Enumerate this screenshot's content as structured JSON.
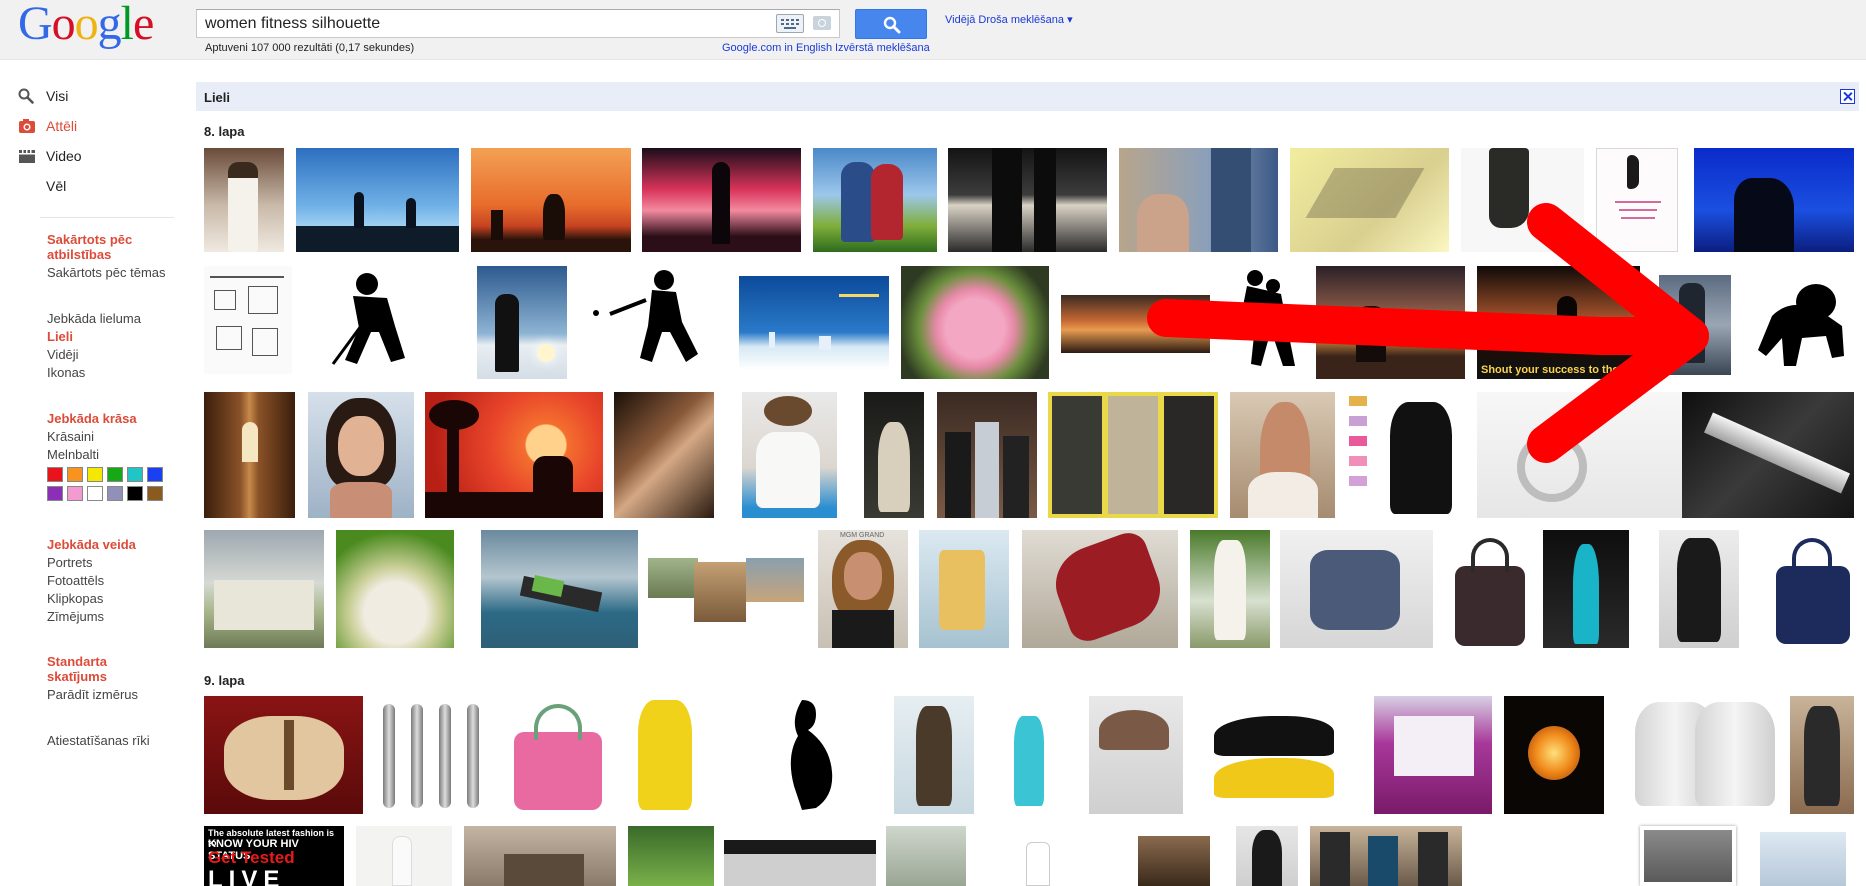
{
  "header": {
    "logo": "Google",
    "search_value": "women fitness silhouette",
    "safe_search": "Vidējā Droša meklēšana ▾",
    "result_stats": "Aptuveni 107 000 rezultāti (0,17 sekundes)",
    "lang_link": "Google.com in English",
    "advanced_link": "Izvērstā meklēšana"
  },
  "sidebar": {
    "nav": [
      {
        "label": "Visi",
        "icon": "search-icon"
      },
      {
        "label": "Attēli",
        "icon": "camera-icon"
      },
      {
        "label": "Video",
        "icon": "film-icon"
      },
      {
        "label": "Vēl",
        "icon": ""
      }
    ],
    "sort_head": "Sakārtots pēc atbilstības",
    "sort_alt": "Sakārtots pēc tēmas",
    "size_options": [
      "Jebkāda lieluma",
      "Lieli",
      "Vidēji",
      "Ikonas"
    ],
    "color_head": "Jebkāda krāsa",
    "color_options": [
      "Krāsaini",
      "Melnbalti"
    ],
    "swatches": [
      "#e8131b",
      "#f7931e",
      "#f5e800",
      "#16a815",
      "#22c5c5",
      "#1b3ff2",
      "#8b2fb8",
      "#f39ad1",
      "#ffffff",
      "#9090b8",
      "#000000",
      "#8b5a1e"
    ],
    "type_head": "Jebkāda veida",
    "type_options": [
      "Portrets",
      "Fotoattēls",
      "Klipkopas",
      "Zīmējums"
    ],
    "view_head": "Standarta skatījums",
    "view_link": "Parādīt izmērus",
    "reset": "Atiestatīšanas rīki"
  },
  "results": {
    "filter_label": "Lieli",
    "page8_label": "8. lapa",
    "page9_label": "9. lapa",
    "overlay_text": "Shout your success to the",
    "hiv_lines": [
      "The absolute latest fashion is to",
      "KNOW YOUR HIV STATUS",
      "Get Tested",
      "LIVE"
    ],
    "mgm_label": "MGM GRAND"
  }
}
